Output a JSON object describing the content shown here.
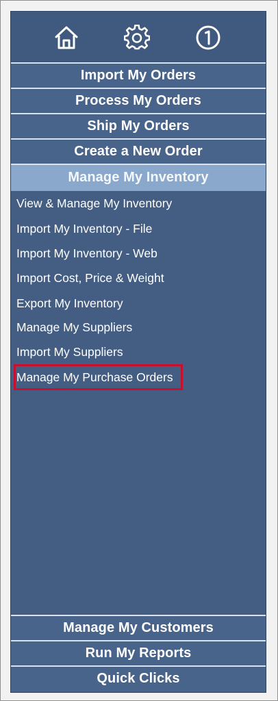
{
  "toolbar": {
    "icons": [
      "home-icon",
      "gear-icon",
      "info-icon"
    ]
  },
  "nav": {
    "import_orders": "Import My Orders",
    "process_orders": "Process My Orders",
    "ship_orders": "Ship My Orders",
    "create_order": "Create a New Order",
    "manage_inventory": "Manage My Inventory",
    "manage_customers": "Manage My Customers",
    "run_reports": "Run My Reports",
    "quick_clicks": "Quick Clicks"
  },
  "inventory_menu": {
    "items": [
      "View & Manage My Inventory",
      "Import My Inventory - File",
      "Import My Inventory - Web",
      "Import Cost, Price & Weight",
      "Export My Inventory",
      "Manage My Suppliers",
      "Import My Suppliers",
      "Manage My Purchase Orders"
    ],
    "highlighted": "Manage My Purchase Orders"
  },
  "colors": {
    "panel": "#435e82",
    "button": "#49648a",
    "active": "#8aa7cc",
    "highlight": "#c8102e"
  }
}
